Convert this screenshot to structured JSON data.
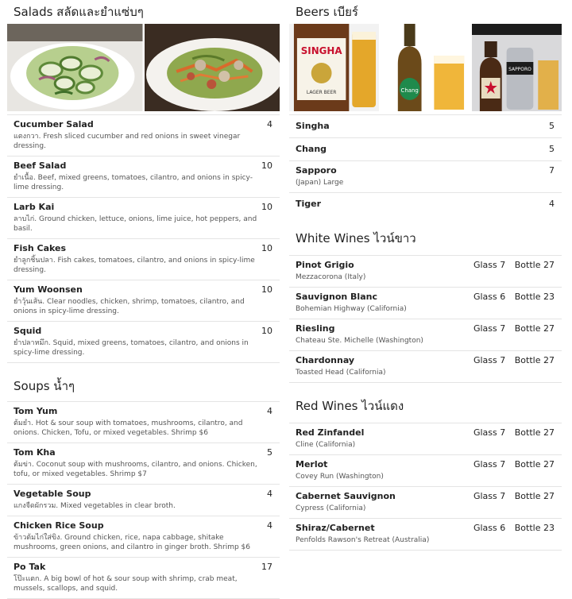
{
  "salads": {
    "title": "Salads สลัดและยำแซ่บๆ",
    "items": [
      {
        "name": "Cucumber Salad",
        "price": "4",
        "desc": "แตงกวา. Fresh sliced cucumber and red onions in sweet vinegar dressing."
      },
      {
        "name": "Beef Salad",
        "price": "10",
        "desc": "ยำเนื้อ. Beef, mixed greens, tomatoes, cilantro, and onions in spicy-lime dressing."
      },
      {
        "name": "Larb Kai",
        "price": "10",
        "desc": "ลาบไก่. Ground chicken, lettuce, onions, lime juice, hot peppers, and basil."
      },
      {
        "name": "Fish Cakes",
        "price": "10",
        "desc": "ยำลูกชิ้นปลา. Fish cakes, tomatoes, cilantro, and onions in spicy-lime dressing."
      },
      {
        "name": "Yum Woonsen",
        "price": "10",
        "desc": "ยำวุ้นเส้น. Clear noodles, chicken, shrimp, tomatoes, cilantro, and onions in spicy-lime dressing."
      },
      {
        "name": "Squid",
        "price": "10",
        "desc": "ยำปลาหมึก. Squid, mixed greens, tomatoes, cilantro, and onions in spicy-lime dressing."
      }
    ]
  },
  "soups": {
    "title": "Soups น้ำๆ",
    "items": [
      {
        "name": "Tom Yum",
        "price": "4",
        "desc": "ต้มยำ. Hot & sour soup with tomatoes, mushrooms, cilantro, and onions. Chicken, Tofu, or mixed vegetables. Shrimp $6"
      },
      {
        "name": "Tom Kha",
        "price": "5",
        "desc": "ต้มข่า. Coconut soup with mushrooms, cilantro, and onions. Chicken, tofu, or mixed vegetables. Shrimp $7"
      },
      {
        "name": "Vegetable Soup",
        "price": "4",
        "desc": "แกงจืดผักรวม. Mixed vegetables in clear broth."
      },
      {
        "name": "Chicken Rice Soup",
        "price": "4",
        "desc": "ข้าวต้มไก่ใส่ขิง. Ground chicken, rice, napa cabbage, shitake mushrooms, green onions, and cilantro in ginger broth. Shrimp $6"
      },
      {
        "name": "Po Tak",
        "price": "17",
        "desc": "โป๊ะแตก. A big bowl of hot & sour soup with shrimp, crab meat, mussels, scallops, and squid."
      }
    ]
  },
  "beers": {
    "title": "Beers เบียร์",
    "photo_labels": [
      "SINGHA",
      "LAGER BEER",
      "Chang",
      "SAPPORO"
    ],
    "items": [
      {
        "name": "Singha",
        "price": "5",
        "desc": ""
      },
      {
        "name": "Chang",
        "price": "5",
        "desc": ""
      },
      {
        "name": "Sapporo",
        "price": "7",
        "desc": "(Japan) Large"
      },
      {
        "name": "Tiger",
        "price": "4",
        "desc": ""
      }
    ]
  },
  "white_wines": {
    "title": "White Wines ไวน์ขาว",
    "glass_label": "Glass",
    "bottle_label": "Bottle",
    "items": [
      {
        "name": "Pinot Grigio",
        "origin": "Mezzacorona (Italy)",
        "glass": "7",
        "bottle": "27"
      },
      {
        "name": "Sauvignon Blanc",
        "origin": "Bohemian Highway (California)",
        "glass": "6",
        "bottle": "23"
      },
      {
        "name": "Riesling",
        "origin": "Chateau Ste. Michelle (Washington)",
        "glass": "7",
        "bottle": "27"
      },
      {
        "name": "Chardonnay",
        "origin": "Toasted Head (California)",
        "glass": "7",
        "bottle": "27"
      }
    ]
  },
  "red_wines": {
    "title": "Red Wines ไวน์แดง",
    "glass_label": "Glass",
    "bottle_label": "Bottle",
    "items": [
      {
        "name": "Red Zinfandel",
        "origin": "Cline (California)",
        "glass": "7",
        "bottle": "27"
      },
      {
        "name": "Merlot",
        "origin": "Covey Run (Washington)",
        "glass": "7",
        "bottle": "27"
      },
      {
        "name": "Cabernet Sauvignon",
        "origin": "Cypress (California)",
        "glass": "7",
        "bottle": "27"
      },
      {
        "name": "Shiraz/Cabernet",
        "origin": "Penfolds Rawson's Retreat (Australia)",
        "glass": "6",
        "bottle": "23"
      }
    ]
  }
}
